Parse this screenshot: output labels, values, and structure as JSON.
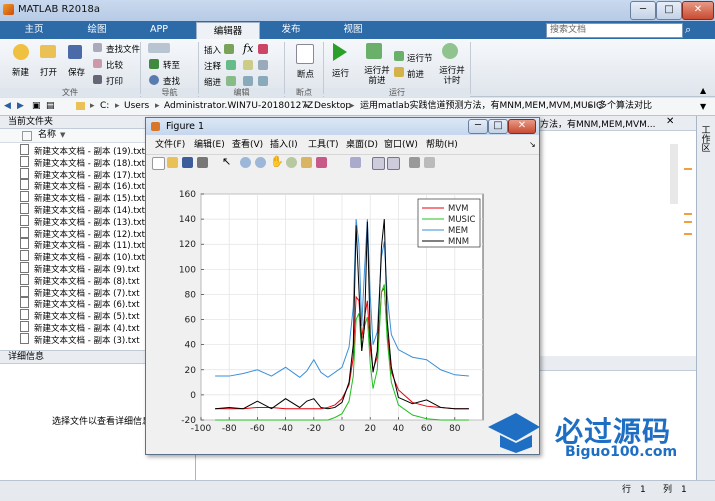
{
  "app": {
    "title": "MATLAB R2018a"
  },
  "tabs": [
    "主页",
    "绘图",
    "APP",
    "编辑器",
    "发布",
    "视图"
  ],
  "active_tab": "编辑器",
  "search": {
    "placeholder": "搜索文档"
  },
  "toolstrip": {
    "file": {
      "new": "新建",
      "open": "打开",
      "save": "保存",
      "find_files": "查找文件",
      "compare": "比较",
      "print": "打印",
      "group": "文件"
    },
    "nav": {
      "goto": "转至",
      "find": "查找",
      "group": "导航"
    },
    "edit": {
      "insert": "插入",
      "comment": "注释",
      "indent": "缩进",
      "fx": "fx",
      "group": "编辑"
    },
    "breakpoints": {
      "label": "断点",
      "group": "断点"
    },
    "run": {
      "run": "运行",
      "run_advance": "运行并\n前进",
      "run_section": "运行节",
      "advance": "前进",
      "run_time": "运行并\n计时",
      "group": "运行"
    }
  },
  "address": {
    "segments": [
      "C:",
      "Users",
      "Administrator.WIN7U-20180127Z",
      "Desktop",
      "运用matlab实践信道预测方法，有MNM,MEM,MVM,MUSIC",
      "多个算法对比"
    ],
    "sep": "▸"
  },
  "left_panel": {
    "header": "当前文件夹",
    "column": "名称",
    "sort_arrow": "▼",
    "files": [
      "新建文本文档 - 副本 (19).txt",
      "新建文本文档 - 副本 (18).txt",
      "新建文本文档 - 副本 (17).txt",
      "新建文本文档 - 副本 (16).txt",
      "新建文本文档 - 副本 (15).txt",
      "新建文本文档 - 副本 (14).txt",
      "新建文本文档 - 副本 (13).txt",
      "新建文本文档 - 副本 (12).txt",
      "新建文本文档 - 副本 (11).txt",
      "新建文本文档 - 副本 (10).txt",
      "新建文本文档 - 副本 (9).txt",
      "新建文本文档 - 副本 (8).txt",
      "新建文本文档 - 副本 (7).txt",
      "新建文本文档 - 副本 (6).txt",
      "新建文本文档 - 副本 (5).txt",
      "新建文本文档 - 副本 (4).txt",
      "新建文本文档 - 副本 (3).txt"
    ],
    "details_header": "详细信息",
    "details_text": "选择文件以查看详细信息"
  },
  "editor_path_snippet": "方法，有MNM,MEM,MVM...",
  "workspace_label": "工作区",
  "status": {
    "row_label": "行",
    "row": "1",
    "col_label": "列",
    "col": "1"
  },
  "figure": {
    "title": "Figure 1",
    "menu": [
      "文件(F)",
      "编辑(E)",
      "查看(V)",
      "插入(I)",
      "工具(T)",
      "桌面(D)",
      "窗口(W)",
      "帮助(H)"
    ]
  },
  "watermark": {
    "text": "必过源码",
    "url": "Biguo100.com"
  },
  "colors": {
    "MVM": "#e8000b",
    "MUSIC": "#1fc01f",
    "MEM": "#3a8fd8",
    "MNM": "#000000"
  },
  "chart_data": {
    "type": "line",
    "title": "",
    "xlabel": "",
    "ylabel": "",
    "xlim": [
      -100,
      100
    ],
    "ylim": [
      -20,
      160
    ],
    "xticks": [
      -100,
      -80,
      -60,
      -40,
      -20,
      0,
      20,
      40,
      60,
      80
    ],
    "yticks": [
      -20,
      0,
      20,
      40,
      60,
      80,
      100,
      120,
      140,
      160
    ],
    "grid": true,
    "legend_position": "top-right",
    "x": [
      -90,
      -80,
      -70,
      -60,
      -50,
      -40,
      -30,
      -25,
      -20,
      -15,
      -10,
      -5,
      0,
      5,
      8,
      10,
      12,
      14,
      16,
      18,
      20,
      22,
      25,
      28,
      30,
      32,
      35,
      40,
      50,
      60,
      70,
      80,
      90
    ],
    "series": [
      {
        "name": "MVM",
        "values": [
          -11,
          -11,
          -11,
          -10,
          -10,
          -11,
          -11,
          -11,
          -11,
          -11,
          -10,
          -8,
          -3,
          8,
          30,
          78,
          75,
          45,
          62,
          75,
          38,
          20,
          30,
          82,
          85,
          50,
          18,
          4,
          -6,
          -9,
          -10,
          -11,
          -11
        ]
      },
      {
        "name": "MUSIC",
        "values": [
          -20,
          -20,
          -20,
          -20,
          -20,
          -20,
          -20,
          -20,
          -20,
          -20,
          -20,
          -18,
          -15,
          -5,
          15,
          60,
          65,
          35,
          55,
          62,
          25,
          5,
          20,
          82,
          88,
          45,
          10,
          -8,
          -16,
          -19,
          -20,
          -20,
          -20
        ]
      },
      {
        "name": "MEM",
        "values": [
          15,
          15,
          17,
          20,
          15,
          22,
          14,
          19,
          28,
          18,
          14,
          18,
          22,
          38,
          70,
          140,
          120,
          55,
          100,
          140,
          80,
          40,
          50,
          110,
          122,
          80,
          48,
          36,
          30,
          28,
          20,
          16,
          15
        ]
      },
      {
        "name": "MNM",
        "values": [
          -11,
          -10,
          -11,
          -5,
          -11,
          -3,
          -10,
          -5,
          -3,
          -10,
          -11,
          -10,
          -6,
          10,
          40,
          135,
          85,
          35,
          55,
          138,
          48,
          18,
          35,
          118,
          140,
          60,
          22,
          -2,
          -7,
          -4,
          -10,
          -11,
          -11
        ]
      }
    ]
  }
}
